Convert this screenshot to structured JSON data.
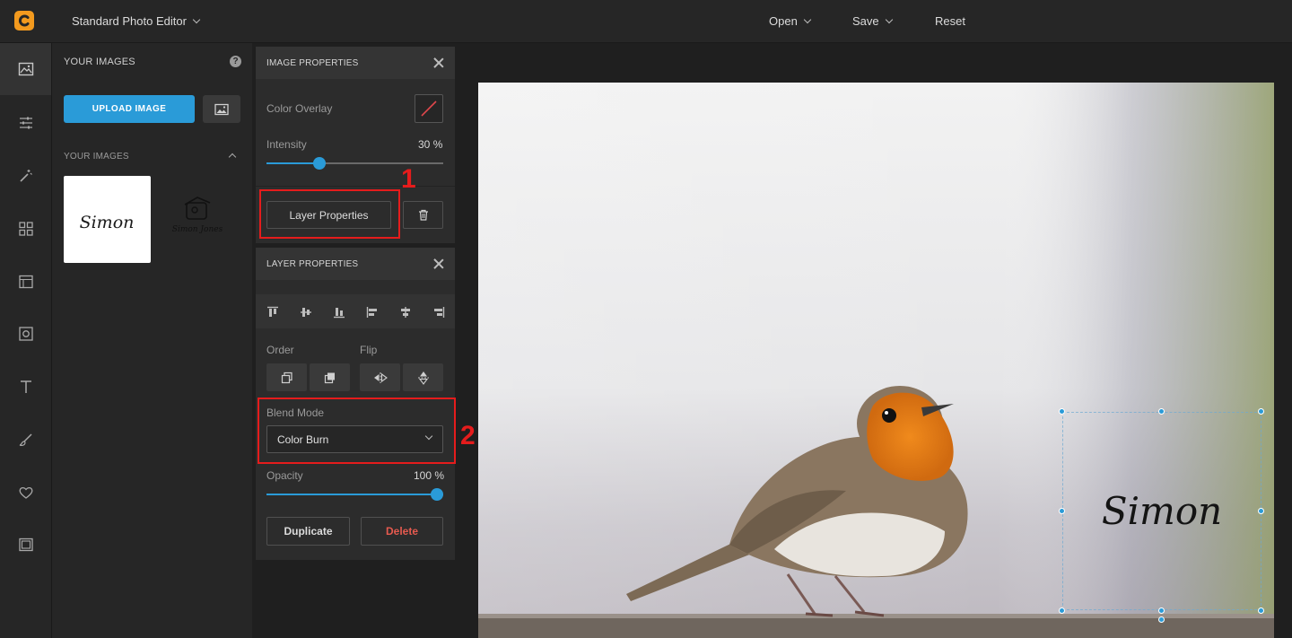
{
  "topbar": {
    "app_title": "Standard Photo Editor",
    "menu": [
      {
        "label": "Open"
      },
      {
        "label": "Save"
      },
      {
        "label": "Reset"
      }
    ]
  },
  "rail": {
    "items": [
      {
        "icon": "image-icon",
        "active": true
      },
      {
        "icon": "sliders-icon"
      },
      {
        "icon": "magic-wand-icon"
      },
      {
        "icon": "grid-icon"
      },
      {
        "icon": "texture-icon"
      },
      {
        "icon": "frame-icon"
      },
      {
        "icon": "text-icon"
      },
      {
        "icon": "brush-icon"
      },
      {
        "icon": "heart-icon"
      },
      {
        "icon": "border-icon"
      }
    ]
  },
  "images_panel": {
    "title": "YOUR IMAGES",
    "upload_label": "UPLOAD IMAGE",
    "section_label": "YOUR IMAGES",
    "thumb1_text": "Simon",
    "thumb2_text": "Simon Jones"
  },
  "image_properties": {
    "title": "IMAGE PROPERTIES",
    "color_overlay_label": "Color Overlay",
    "intensity_label": "Intensity",
    "intensity_value": "30",
    "intensity_unit": "%",
    "intensity_fraction": 0.3,
    "layer_properties_label": "Layer Properties"
  },
  "layer_properties": {
    "title": "LAYER PROPERTIES",
    "order_label": "Order",
    "flip_label": "Flip",
    "blend_mode_label": "Blend Mode",
    "blend_mode_value": "Color Burn",
    "opacity_label": "Opacity",
    "opacity_value": "100",
    "opacity_unit": "%",
    "opacity_fraction": 1.0,
    "duplicate_label": "Duplicate",
    "delete_label": "Delete"
  },
  "annotations": {
    "marker1": "1",
    "marker2": "2"
  },
  "canvas": {
    "signature_text": "Simon"
  },
  "colors": {
    "accent": "#2a9bd8",
    "annotation": "#e51c1c",
    "delete_text": "#e55a4f"
  }
}
